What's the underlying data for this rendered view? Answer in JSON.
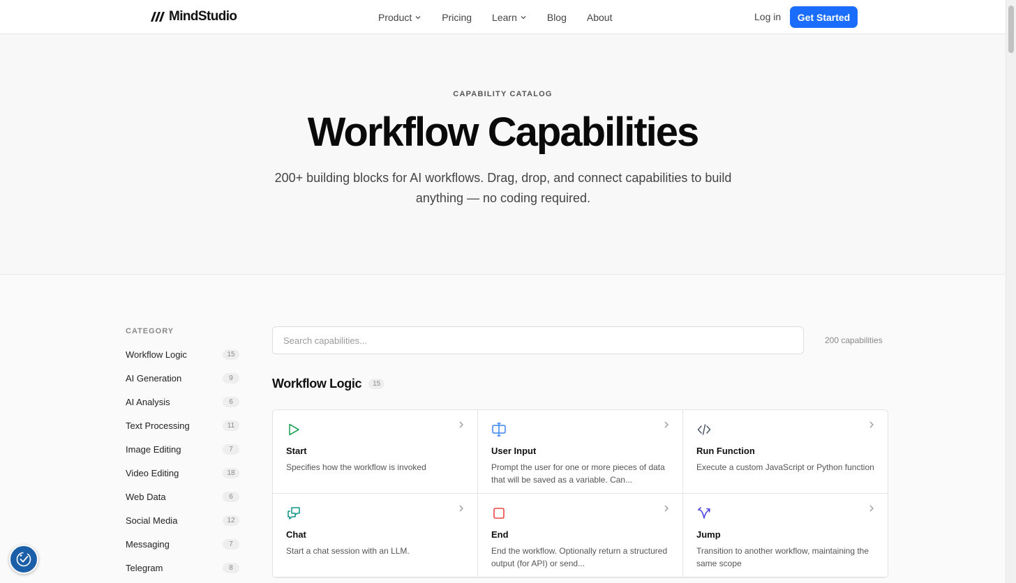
{
  "header": {
    "logo_text": "MindStudio",
    "nav": [
      {
        "label": "Product",
        "has_dropdown": true
      },
      {
        "label": "Pricing",
        "has_dropdown": false
      },
      {
        "label": "Learn",
        "has_dropdown": true
      },
      {
        "label": "Blog",
        "has_dropdown": false
      },
      {
        "label": "About",
        "has_dropdown": false
      }
    ],
    "login_label": "Log in",
    "cta_label": "Get Started"
  },
  "hero": {
    "eyebrow": "CAPABILITY CATALOG",
    "title": "Workflow Capabilities",
    "subtitle": "200+ building blocks for AI workflows. Drag, drop, and connect capabilities to build anything — no coding required."
  },
  "sidebar": {
    "heading": "CATEGORY",
    "items": [
      {
        "label": "Workflow Logic",
        "count": "15"
      },
      {
        "label": "AI Generation",
        "count": "9"
      },
      {
        "label": "AI Analysis",
        "count": "6"
      },
      {
        "label": "Text Processing",
        "count": "11"
      },
      {
        "label": "Image Editing",
        "count": "7"
      },
      {
        "label": "Video Editing",
        "count": "18"
      },
      {
        "label": "Web Data",
        "count": "6"
      },
      {
        "label": "Social Media",
        "count": "12"
      },
      {
        "label": "Messaging",
        "count": "7"
      },
      {
        "label": "Telegram",
        "count": "8"
      }
    ]
  },
  "search": {
    "placeholder": "Search capabilities...",
    "value": ""
  },
  "capability_total": "200 capabilities",
  "section": {
    "title": "Workflow Logic",
    "count": "15",
    "cards": [
      {
        "title": "Start",
        "description": "Specifies how the workflow is invoked",
        "icon": "play-icon",
        "icon_color": "#22a559"
      },
      {
        "title": "User Input",
        "description": "Prompt the user for one or more pieces of data that will be saved as a variable. Can...",
        "icon": "user-input-icon",
        "icon_color": "#3b82f6"
      },
      {
        "title": "Run Function",
        "description": "Execute a custom JavaScript or Python function",
        "icon": "code-icon",
        "icon_color": "#4b5563"
      },
      {
        "title": "Chat",
        "description": "Start a chat session with an LLM.",
        "icon": "chat-icon",
        "icon_color": "#0d9488"
      },
      {
        "title": "End",
        "description": "End the workflow. Optionally return a structured output (for API) or send...",
        "icon": "stop-icon",
        "icon_color": "#ef4444"
      },
      {
        "title": "Jump",
        "description": "Transition to another workflow, maintaining the same scope",
        "icon": "branch-icon",
        "icon_color": "#4f46e5"
      }
    ]
  },
  "colors": {
    "accent": "#1a6dff",
    "a11y_widget": "#1b5fa8"
  }
}
